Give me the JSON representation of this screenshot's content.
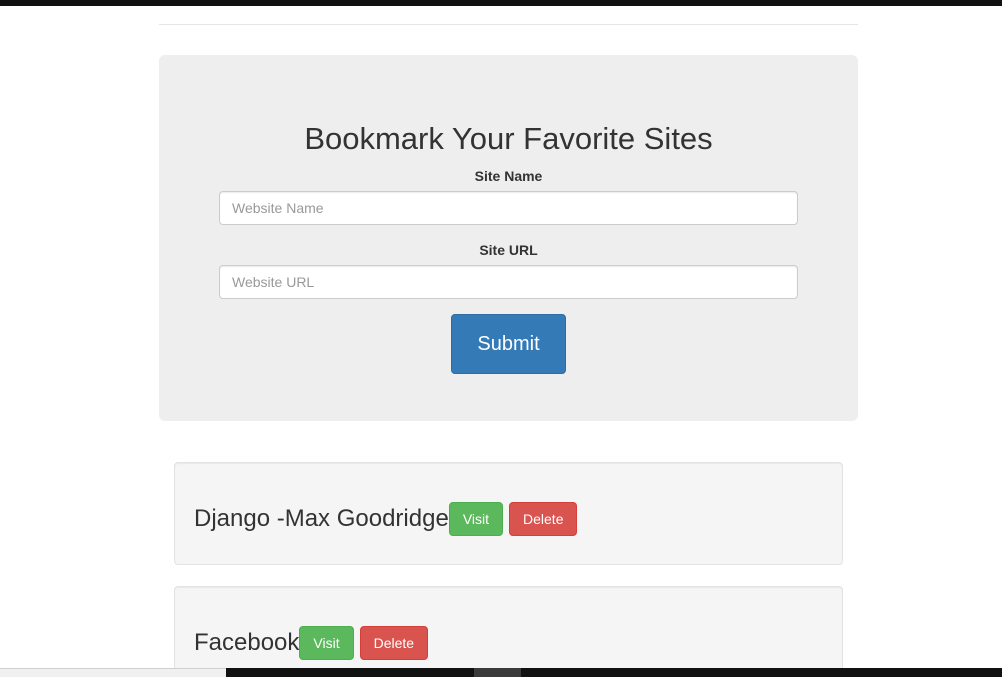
{
  "form": {
    "title": "Bookmark Your Favorite Sites",
    "site_name_label": "Site Name",
    "site_name_placeholder": "Website Name",
    "site_name_value": "",
    "site_url_label": "Site URL",
    "site_url_placeholder": "Website URL",
    "site_url_value": "",
    "submit_label": "Submit"
  },
  "bookmarks": [
    {
      "name": "Django -Max Goodridge",
      "visit_label": "Visit",
      "delete_label": "Delete"
    },
    {
      "name": "Facebook",
      "visit_label": "Visit",
      "delete_label": "Delete"
    }
  ],
  "colors": {
    "primary": "#337ab7",
    "success": "#5cb85c",
    "danger": "#d9534f",
    "jumbotron_bg": "#eeeeee",
    "well_bg": "#f5f5f5"
  }
}
